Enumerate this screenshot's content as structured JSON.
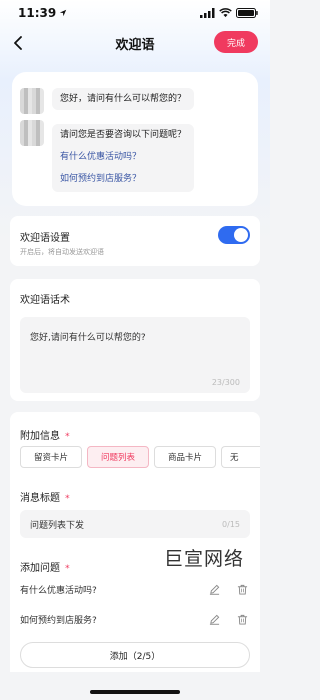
{
  "status_bar": {
    "time": "11:39"
  },
  "nav": {
    "title": "欢迎语",
    "done_label": "完成"
  },
  "preview": {
    "bubble1": "您好，请问有什么可以帮您的？",
    "bubble2_intro": "请问您是否要咨询以下问题呢？",
    "bubble2_links": [
      "有什么优惠活动吗？",
      "如何预约到店服务？"
    ]
  },
  "welcome_setting": {
    "title": "欢迎语设置",
    "subtitle": "开启后，将自动发送欢迎语",
    "enabled": true,
    "accent": "#2f6bf0"
  },
  "welcome_text": {
    "title": "欢迎语话术",
    "value": "您好,请问有什么可以帮您的?",
    "counter": "23/300"
  },
  "attach": {
    "title": "附加信息",
    "required_mark": "*",
    "chips": [
      "留资卡片",
      "问题列表",
      "商品卡片",
      "无"
    ],
    "active_chip": "问题列表",
    "msg_title_label": "消息标题",
    "msg_title_value": "问题列表下发",
    "msg_title_counter": "0/15",
    "questions_label": "添加问题",
    "questions": [
      "有什么优惠活动吗?",
      "如何预约到店服务?"
    ],
    "add_button": "添加（2/5）"
  },
  "watermark": "巨宣网络",
  "colors": {
    "brand": "#f03a5f",
    "accent": "#2f6bf0"
  }
}
